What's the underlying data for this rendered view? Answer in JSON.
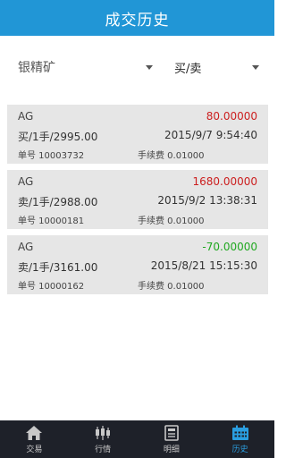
{
  "header": {
    "title": "成交历史"
  },
  "filters": {
    "product": "银精矿",
    "side": "买/卖"
  },
  "trades": [
    {
      "symbol": "AG",
      "amount": "80.00000",
      "amount_color": "#cc1f1f",
      "detail": "买/1手/2995.00",
      "time": "2015/9/7 9:54:40",
      "order": "单号 10003732",
      "fee": "手续费 0.01000"
    },
    {
      "symbol": "AG",
      "amount": "1680.00000",
      "amount_color": "#cc1f1f",
      "detail": "卖/1手/2988.00",
      "time": "2015/9/2 13:38:31",
      "order": "单号 10000181",
      "fee": "手续费 0.01000"
    },
    {
      "symbol": "AG",
      "amount": "-70.00000",
      "amount_color": "#21a821",
      "detail": "卖/1手/3161.00",
      "time": "2015/8/21 15:15:30",
      "order": "单号 10000162",
      "fee": "手续费 0.01000"
    }
  ],
  "tabs": [
    {
      "label": "交易",
      "icon": "home-icon"
    },
    {
      "label": "行情",
      "icon": "candlestick-icon"
    },
    {
      "label": "明细",
      "icon": "detail-icon"
    },
    {
      "label": "历史",
      "icon": "calendar-icon",
      "active": true
    }
  ],
  "colors": {
    "header": "#2196d6",
    "tabbar": "#1e2129",
    "active_tab": "#2a9ee0"
  }
}
